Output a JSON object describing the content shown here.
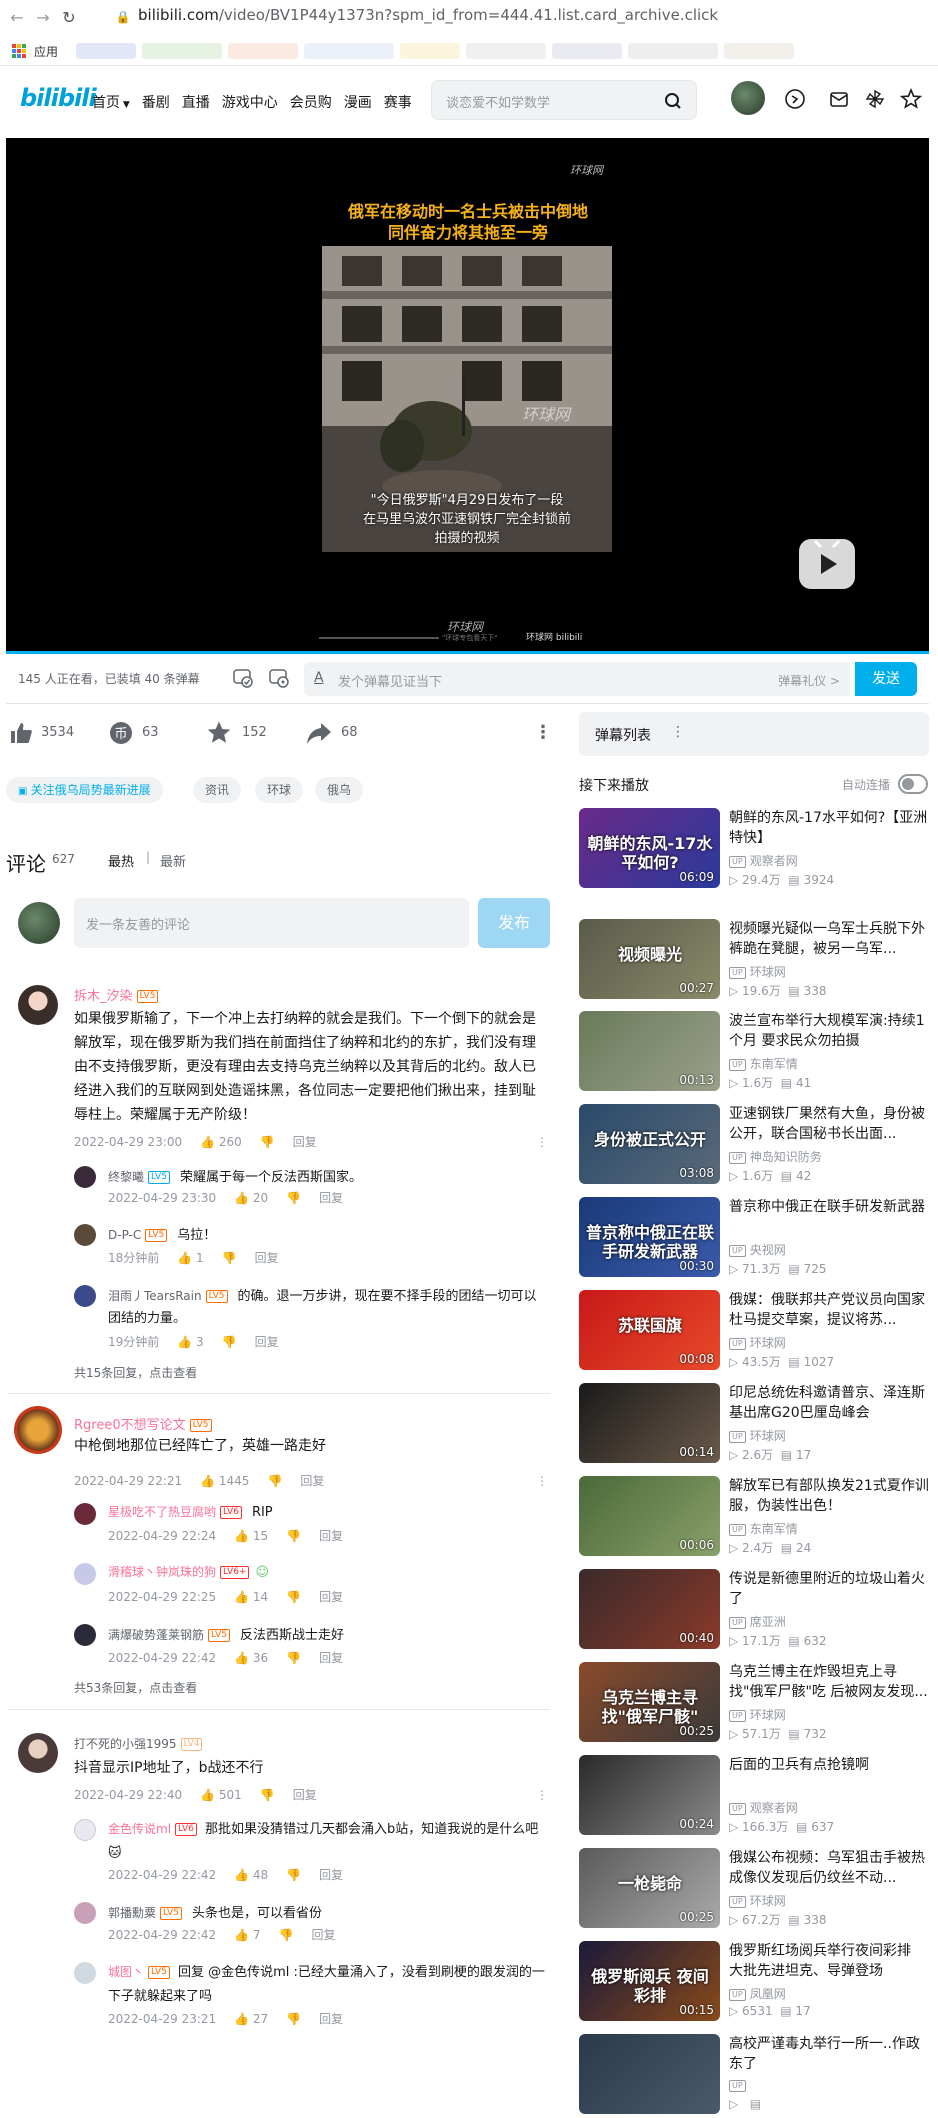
{
  "browser": {
    "url_host": "bilibili.com",
    "url_path": "/video/BV1P44y1373n?spm_id_from=444.41.list.card_archive.click",
    "bookmark_apps": "应用"
  },
  "header": {
    "logo": "bilibili",
    "menu": [
      "首页",
      "番剧",
      "直播",
      "游戏中心",
      "会员购",
      "漫画",
      "赛事"
    ],
    "search_placeholder": "谈恋爱不如学数学"
  },
  "video": {
    "watermark_top": "环球网",
    "title_line1": "俄军在移动时一名士兵被击中倒地",
    "title_line2": "同伴奋力将其拖至一旁",
    "frame_watermark": "环球网",
    "subtitle_line1": "\"今日俄罗斯\"4月29日发布了一段",
    "subtitle_line2": "在马里乌波尔亚速钢铁厂完全封锁前",
    "subtitle_line3": "拍摄的视频",
    "bottom_watermark": "环球网",
    "bottom_small": "\"环球专包看天下\"",
    "bottom_brand": "环球网 bilibili"
  },
  "sendbar": {
    "viewers": "145 人正在看，已装填 40 条弹幕",
    "placeholder": "发个弹幕见证当下",
    "etiquette": "弹幕礼仪 >",
    "send": "发送"
  },
  "actions": {
    "like": "3534",
    "coin": "63",
    "fav": "152",
    "share": "68"
  },
  "tags": [
    "关注俄乌局势最新进展",
    "资讯",
    "环球",
    "俄乌"
  ],
  "comments": {
    "label": "评论",
    "count": "627",
    "sort_hot": "最热",
    "sort_new": "最新",
    "input_placeholder": "发一条友善的评论",
    "publish": "发布",
    "reply_label": "回复",
    "threads": [
      {
        "user": "拆木_汐染",
        "level": "LV5",
        "text": "如果俄罗斯输了，下一个冲上去打纳粹的就会是我们。下一个倒下的就会是解放军，现在俄罗斯为我们挡在前面挡住了纳粹和北约的东扩，我们没有理由不支持俄罗斯，更没有理由去支持乌克兰纳粹以及其背后的北约。敌人已经进入我们的互联网到处造谣抹黑，各位同志一定要把他们揪出来，挂到耻辱柱上。荣耀属于无产阶级！",
        "time": "2022-04-29 23:00",
        "likes": "260",
        "replies": [
          {
            "user": "终黎曦",
            "level": "LV5",
            "text": "荣耀属于每一个反法西斯国家。",
            "time": "2022-04-29 23:30",
            "likes": "20"
          },
          {
            "user": "D-P-C",
            "level": "LV5",
            "text": "乌拉！",
            "time": "18分钟前",
            "likes": "1"
          },
          {
            "user": "泪雨丿TearsRain",
            "level": "LV5",
            "text": "的确。退一万步讲，现在要不择手段的团结一切可以团结的力量。",
            "time": "19分钟前",
            "likes": "3"
          }
        ],
        "more": "共15条回复，点击查看"
      },
      {
        "user": "Rgree0不想写论文",
        "level": "LV5",
        "text": "中枪倒地那位已经阵亡了，英雄一路走好",
        "time": "2022-04-29 22:21",
        "likes": "1445",
        "replies": [
          {
            "user": "星极吃不了热豆腐哟",
            "level": "LV6",
            "text": "RIP",
            "time": "2022-04-29 22:24",
            "likes": "15"
          },
          {
            "user": "滑稽球丶钟岚珠的狗",
            "level": "LV6+",
            "text": "",
            "time": "2022-04-29 22:25",
            "likes": "14"
          },
          {
            "user": "满爆破势蓬莱钢筋",
            "level": "LV5",
            "text": "反法西斯战士走好",
            "time": "2022-04-29 22:42",
            "likes": "36"
          }
        ],
        "more": "共53条回复，点击查看"
      },
      {
        "user": "打不死的小强1995",
        "level": "LV4",
        "text": "抖音显示IP地址了，b战还不行",
        "time": "2022-04-29 22:40",
        "likes": "501",
        "replies": [
          {
            "user": "金色传说ml",
            "level": "LV6",
            "text": "那批如果没猜错过几天都会涌入b站，知道我说的是什么吧🐱",
            "time": "2022-04-29 22:42",
            "likes": "48"
          },
          {
            "user": "郭播勳粟",
            "level": "LV5",
            "text": "头条也是，可以看省份",
            "time": "2022-04-29 22:42",
            "likes": "7"
          },
          {
            "user": "城图丶",
            "level": "LV5",
            "text": "回复 @金色传说ml :已经大量涌入了，没看到刷梗的跟发润的一下子就躲起来了吗",
            "time": "2022-04-29 23:21",
            "likes": "27"
          }
        ]
      }
    ]
  },
  "sidebar": {
    "danmaku_list": "弹幕列表",
    "up_next": "接下来播放",
    "autoplay": "自动连播",
    "recs": [
      {
        "title": "朝鲜的东风-17水平如何?【亚洲特快】",
        "up": "观察者网",
        "views": "29.4万",
        "danmaku": "3924",
        "duration": "06:09",
        "thumb_text": "朝鲜的东风-17水平如何?",
        "c1": "#6a2a8a",
        "c2": "#2a3a9a"
      },
      {
        "title": "视频曝光疑似一乌军士兵脱下外裤跪在凳腿，被另一乌军...",
        "up": "环球网",
        "views": "19.6万",
        "danmaku": "338",
        "duration": "00:27",
        "thumb_text": "视频曝光",
        "c1": "#5a5a4a",
        "c2": "#8a8a6a"
      },
      {
        "title": "波兰宣布举行大规模军演:持续1个月 要求民众勿拍摄",
        "up": "东南军情",
        "views": "1.6万",
        "danmaku": "41",
        "duration": "00:13",
        "thumb_text": "",
        "c1": "#6a7a5a",
        "c2": "#9aa08a"
      },
      {
        "title": "亚速钢铁厂果然有大鱼，身份被公开，联合国秘书长出面...",
        "up": "神岛知识防务",
        "views": "1.6万",
        "danmaku": "42",
        "duration": "03:08",
        "thumb_text": "身份被正式公开",
        "c1": "#2a4a6a",
        "c2": "#5a6a7a"
      },
      {
        "title": "普京称中俄正在联手研发新武器",
        "up": "央视网",
        "views": "71.3万",
        "danmaku": "725",
        "duration": "00:30",
        "thumb_text": "普京称中俄正在联手研发新武器",
        "c1": "#1a3a7a",
        "c2": "#3a5aaa"
      },
      {
        "title": "俄媒：俄联邦共产党议员向国家杜马提交草案，提议将苏...",
        "up": "环球网",
        "views": "43.5万",
        "danmaku": "1027",
        "duration": "00:08",
        "thumb_text": "苏联国旗",
        "c1": "#c81818",
        "c2": "#e84a2a"
      },
      {
        "title": "印尼总统佐科邀请普京、泽连斯基出席G20巴厘岛峰会",
        "up": "环球网",
        "views": "2.6万",
        "danmaku": "17",
        "duration": "00:14",
        "thumb_text": "",
        "c1": "#1a1a1a",
        "c2": "#6a5a4a"
      },
      {
        "title": "解放军已有部队换发21式夏作训服，伪装性出色！",
        "up": "东南军情",
        "views": "2.4万",
        "danmaku": "24",
        "duration": "00:06",
        "thumb_text": "",
        "c1": "#4a6a3a",
        "c2": "#8aa06a"
      },
      {
        "title": "传说是新德里附近的垃圾山着火了",
        "up": "席亚洲",
        "views": "17.1万",
        "danmaku": "632",
        "duration": "00:40",
        "thumb_text": "",
        "c1": "#3a2a2a",
        "c2": "#8a3a2a"
      },
      {
        "title": "乌克兰博主在炸毁坦克上寻找\"俄军尸骸\"吃 后被网友发现...",
        "up": "环球网",
        "views": "57.1万",
        "danmaku": "732",
        "duration": "00:25",
        "thumb_text": "乌克兰博主寻找\"俄军尸骸\"",
        "c1": "#8a4a2a",
        "c2": "#3a3a3a"
      },
      {
        "title": "后面的卫兵有点抢镜啊",
        "up": "观察者网",
        "views": "166.3万",
        "danmaku": "637",
        "duration": "00:24",
        "thumb_text": "",
        "c1": "#2a2a2a",
        "c2": "#8a8a8a"
      },
      {
        "title": "俄媒公布视频：乌军狙击手被热成像仪发现后仍纹丝不动...",
        "up": "环球网",
        "views": "67.2万",
        "danmaku": "338",
        "duration": "00:25",
        "thumb_text": "一枪毙命",
        "c1": "#5a5a5a",
        "c2": "#aaaaaa"
      },
      {
        "title": "俄罗斯红场阅兵举行夜间彩排 大批先进坦克、导弹登场",
        "up": "凤凰网",
        "views": "6531",
        "danmaku": "17",
        "duration": "00:15",
        "thumb_text": "俄罗斯阅兵 夜间彩排",
        "c1": "#1a1a3a",
        "c2": "#8a4a1a"
      },
      {
        "title": "高校严谨毒丸举行一所一..作政东了",
        "up": "",
        "views": "",
        "danmaku": "",
        "duration": "",
        "thumb_text": "",
        "c1": "#2a3a4a",
        "c2": "#4a5a6a"
      }
    ]
  }
}
